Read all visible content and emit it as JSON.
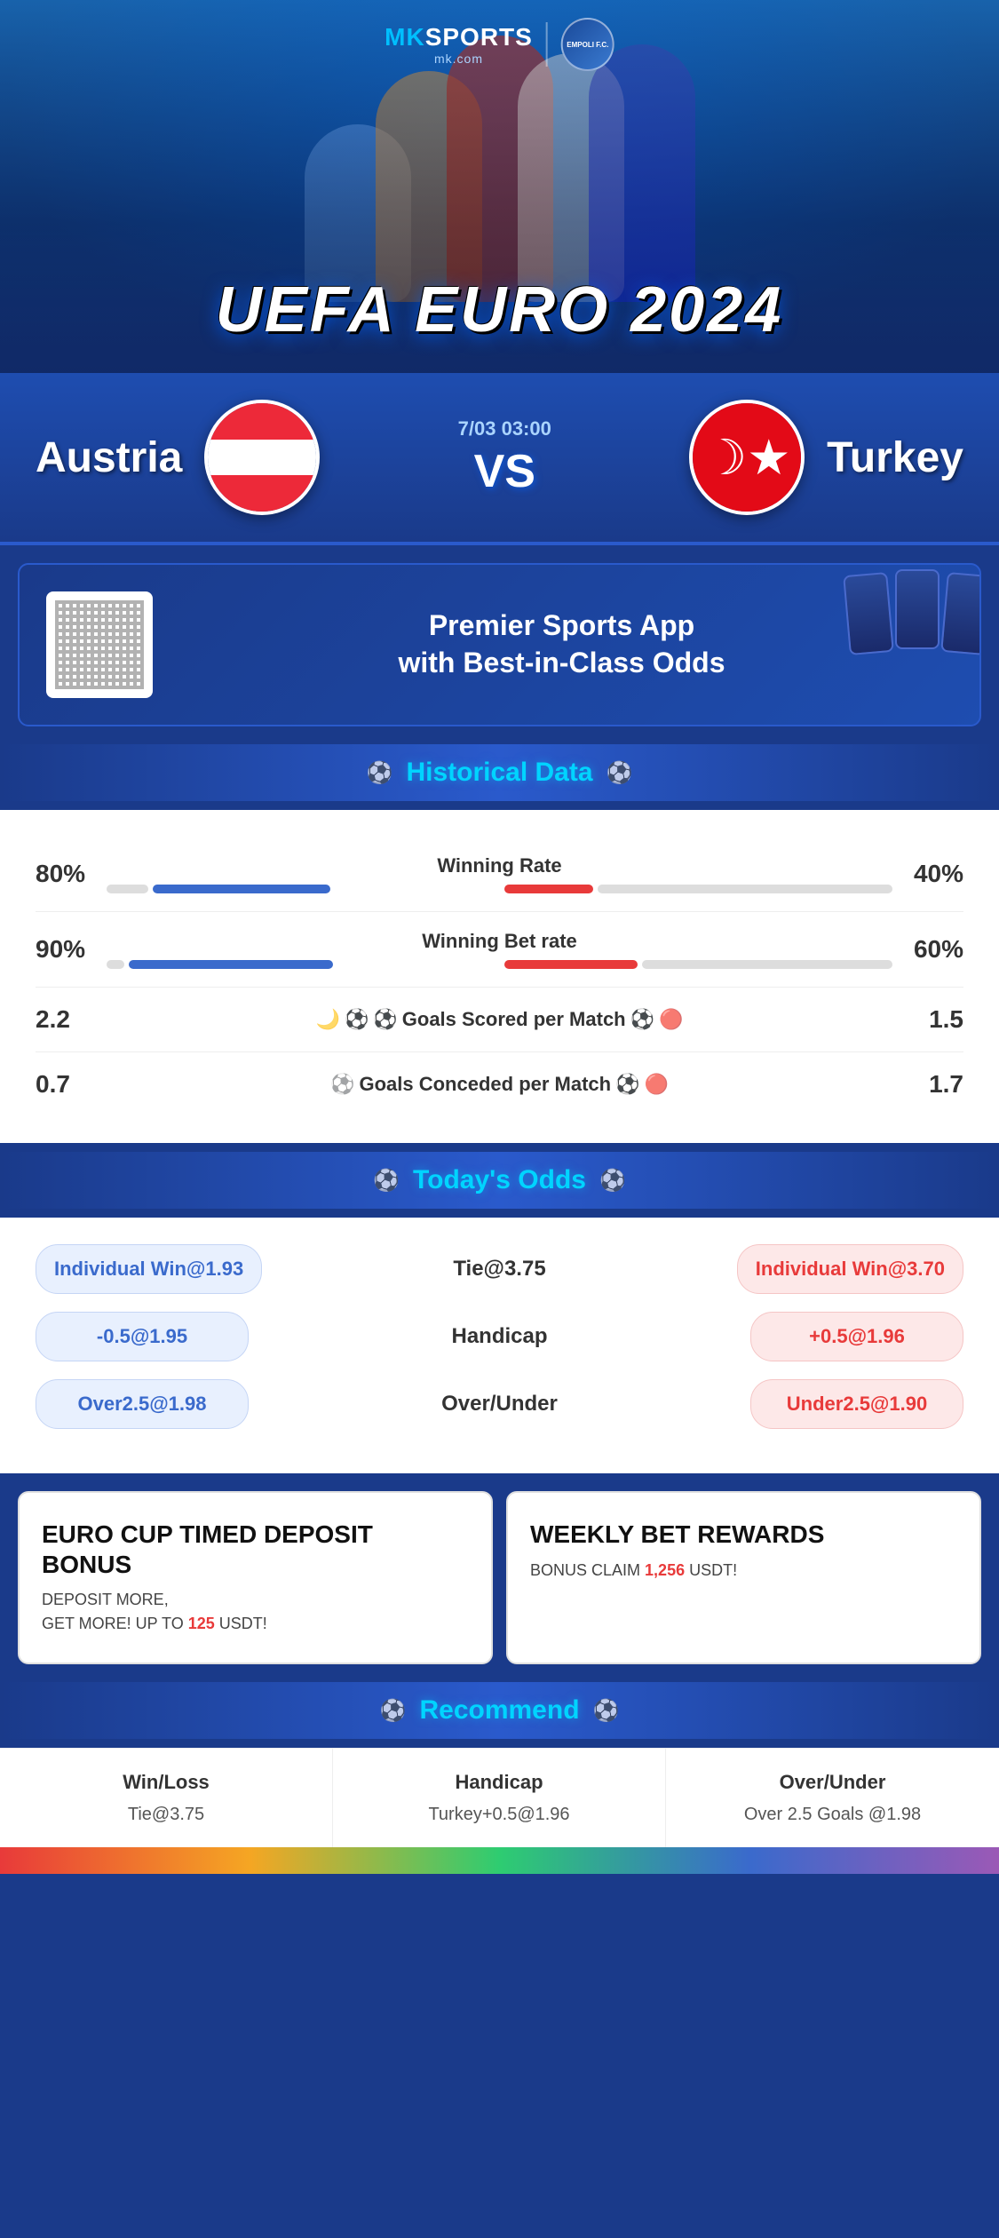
{
  "header": {
    "logo_mk": "MK",
    "logo_sports": "SPORTS",
    "logo_domain": "mk.com",
    "club_abbr": "EMPOLI F.C.",
    "title": "UEFA EURO 2024"
  },
  "match": {
    "team_left": "Austria",
    "team_right": "Turkey",
    "date": "7/03 03:00",
    "vs": "VS"
  },
  "app_promo": {
    "line1": "Premier Sports App",
    "line2": "with Best-in-Class Odds"
  },
  "historical": {
    "section_title": "Historical Data",
    "stats": [
      {
        "label": "Winning Rate",
        "left_val": "80%",
        "right_val": "40%",
        "left_pct": 80,
        "right_pct": 40
      },
      {
        "label": "Winning Bet rate",
        "left_val": "90%",
        "right_val": "60%",
        "left_pct": 90,
        "right_pct": 60
      },
      {
        "label": "Goals Scored per Match",
        "left_val": "2.2",
        "right_val": "1.5"
      },
      {
        "label": "Goals Conceded per Match",
        "left_val": "0.7",
        "right_val": "1.7"
      }
    ]
  },
  "odds": {
    "section_title": "Today's Odds",
    "rows": [
      {
        "left": "Individual Win@1.93",
        "center": "Tie@3.75",
        "right": "Individual Win@3.70",
        "left_type": "blue",
        "right_type": "red"
      },
      {
        "left": "-0.5@1.95",
        "center": "Handicap",
        "right": "+0.5@1.96",
        "left_type": "blue",
        "right_type": "red"
      },
      {
        "left": "Over2.5@1.98",
        "center": "Over/Under",
        "right": "Under2.5@1.90",
        "left_type": "blue",
        "right_type": "red"
      }
    ]
  },
  "bonus": {
    "left": {
      "title": "EURO CUP TIMED DEPOSIT BONUS",
      "desc_line1": "DEPOSIT MORE,",
      "desc_line2": "GET MORE! UP TO",
      "highlight": "125",
      "currency": "USDT!"
    },
    "right": {
      "title": "WEEKLY BET REWARDS",
      "desc": "BONUS CLAIM",
      "highlight": "1,256",
      "currency": "USDT!"
    }
  },
  "recommend": {
    "section_title": "Recommend",
    "columns": [
      {
        "header": "Win/Loss",
        "value": "Tie@3.75"
      },
      {
        "header": "Handicap",
        "value": "Turkey+0.5@1.96"
      },
      {
        "header": "Over/Under",
        "value": "Over 2.5 Goals @1.98"
      }
    ]
  }
}
